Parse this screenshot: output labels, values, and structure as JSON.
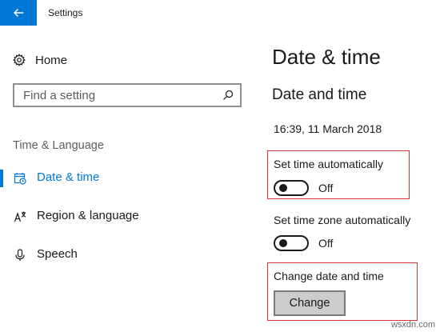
{
  "window": {
    "title": "Settings"
  },
  "sidebar": {
    "home_label": "Home",
    "search_placeholder": "Find a setting",
    "section_label": "Time & Language",
    "items": [
      {
        "label": "Date & time",
        "icon": "calendar-clock-icon",
        "active": true
      },
      {
        "label": "Region & language",
        "icon": "language-icon",
        "active": false
      },
      {
        "label": "Speech",
        "icon": "microphone-icon",
        "active": false
      }
    ]
  },
  "main": {
    "page_title": "Date & time",
    "section_title": "Date and time",
    "current_datetime": "16:39, 11 March 2018",
    "settings": [
      {
        "label": "Set time automatically",
        "state": "Off"
      },
      {
        "label": "Set time zone automatically",
        "state": "Off"
      }
    ],
    "change_section": {
      "label": "Change date and time",
      "button_label": "Change"
    }
  },
  "watermark": "wsxdn.com",
  "colors": {
    "accent": "#0078d7",
    "highlight_box": "#d6343c",
    "button_bg": "#cccccc"
  }
}
